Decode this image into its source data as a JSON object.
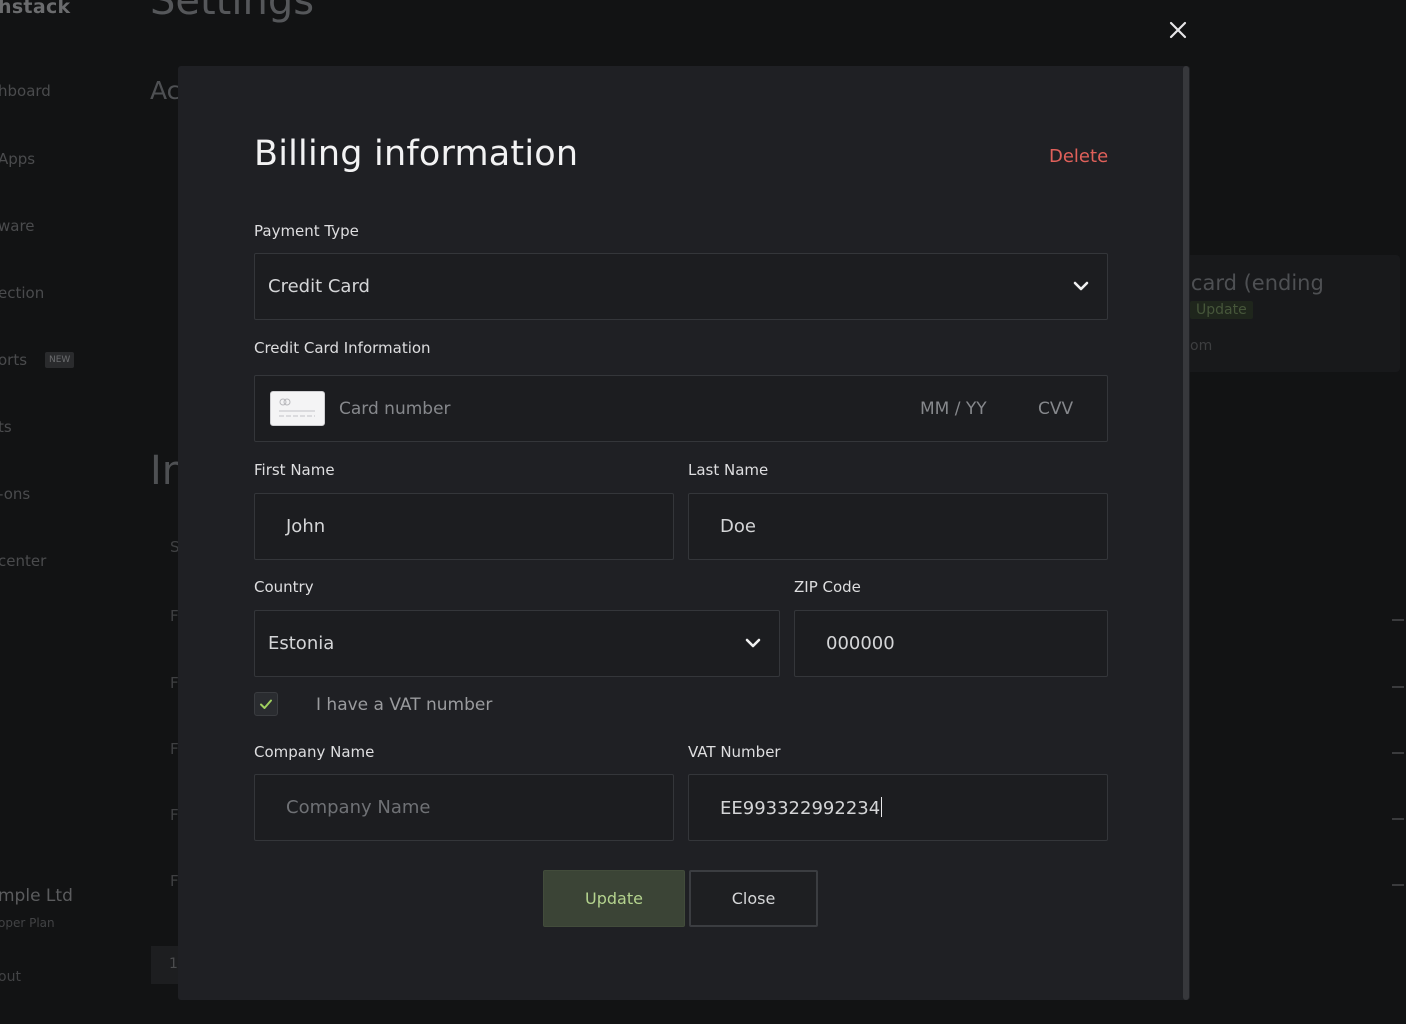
{
  "background": {
    "brand": "hstack",
    "page_title": "Settings",
    "nav_items": [
      "hboard",
      "Apps",
      "ware",
      "ection",
      "orts",
      "ts",
      "-ons",
      "center"
    ],
    "new_badge": "NEW",
    "section_ac": "Ac",
    "section_in": "In",
    "row_letters": [
      "S",
      "F",
      "F",
      "F",
      "F",
      "F"
    ],
    "card_text": "t card (ending",
    "card_update_badge": "Update",
    "card_sub": "om",
    "company": "mple Ltd",
    "plan": "oper Plan",
    "logout": "out",
    "pager": "1"
  },
  "modal": {
    "title": "Billing information",
    "delete_label": "Delete",
    "payment_type": {
      "label": "Payment Type",
      "value": "Credit Card"
    },
    "credit_card": {
      "label": "Credit Card Information",
      "number_placeholder": "Card number",
      "expiry_placeholder": "MM / YY",
      "cvv_placeholder": "CVV"
    },
    "first_name": {
      "label": "First Name",
      "value": "John"
    },
    "last_name": {
      "label": "Last Name",
      "value": "Doe"
    },
    "country": {
      "label": "Country",
      "value": "Estonia"
    },
    "zip": {
      "label": "ZIP Code",
      "value": "000000"
    },
    "vat_checkbox": {
      "label": "I have a VAT number",
      "checked": true
    },
    "company_name": {
      "label": "Company Name",
      "placeholder": "Company Name",
      "value": ""
    },
    "vat_number": {
      "label": "VAT Number",
      "value": "EE993322992234"
    },
    "update_label": "Update",
    "close_label": "Close"
  },
  "colors": {
    "danger": "#e0605a",
    "accent_green": "#b4d38e",
    "modal_bg": "#1f2024"
  },
  "icons": {
    "overlay_close": "close-icon",
    "dropdown": "chevron-down-icon",
    "card": "credit-card-icon",
    "check": "checkmark-icon"
  }
}
